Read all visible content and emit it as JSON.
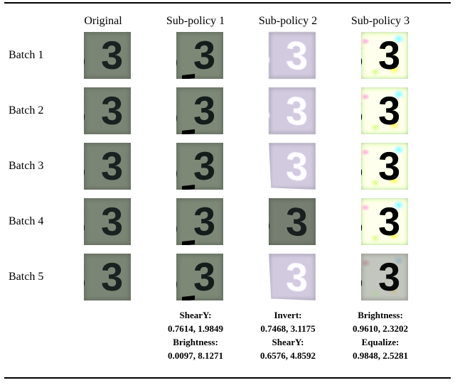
{
  "columns": {
    "c0": "Original",
    "c1": "Sub-policy 1",
    "c2": "Sub-policy 2",
    "c3": "Sub-policy 3"
  },
  "rows": {
    "r1": "Batch 1",
    "r2": "Batch 2",
    "r3": "Batch 3",
    "r4": "Batch 4",
    "r5": "Batch 5"
  },
  "subpolicies": {
    "sp1": {
      "op1_name": "ShearY:",
      "op1_vals": "0.7614, 1.9849",
      "op2_name": "Brightness:",
      "op2_vals": "0.0097, 8.1271"
    },
    "sp2": {
      "op1_name": "Invert:",
      "op1_vals": "0.7468, 3.1175",
      "op2_name": "ShearY:",
      "op2_vals": "0.6576, 4.8592"
    },
    "sp3": {
      "op1_name": "Brightness:",
      "op1_vals": "0.9610, 2.3202",
      "op2_name": "Equalize:",
      "op2_vals": "0.9848, 2.5281"
    }
  },
  "chart_data": {
    "type": "table",
    "rows": [
      "Batch 1",
      "Batch 2",
      "Batch 3",
      "Batch 4",
      "Batch 5"
    ],
    "columns": [
      "Original",
      "Sub-policy 1",
      "Sub-policy 2",
      "Sub-policy 3"
    ],
    "sub_policies": [
      {
        "name": "Sub-policy 1",
        "ops": [
          {
            "op": "ShearY",
            "prob": 0.7614,
            "mag": 1.9849
          },
          {
            "op": "Brightness",
            "prob": 0.0097,
            "mag": 8.1271
          }
        ]
      },
      {
        "name": "Sub-policy 2",
        "ops": [
          {
            "op": "Invert",
            "prob": 0.7468,
            "mag": 3.1175
          },
          {
            "op": "ShearY",
            "prob": 0.6576,
            "mag": 4.8592
          }
        ]
      },
      {
        "name": "Sub-policy 3",
        "ops": [
          {
            "op": "Brightness",
            "prob": 0.961,
            "mag": 2.3202
          },
          {
            "op": "Equalize",
            "prob": 0.9848,
            "mag": 2.5281
          }
        ]
      }
    ]
  }
}
